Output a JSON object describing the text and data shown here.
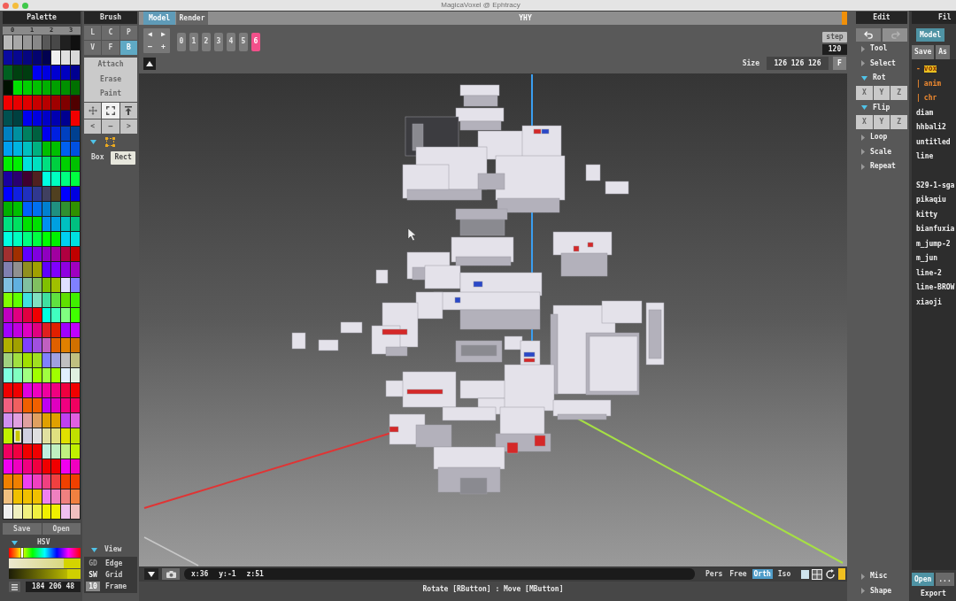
{
  "window": {
    "title": "MagicaVoxel @ Ephtracy"
  },
  "palette": {
    "title": "Palette",
    "pages": [
      "0",
      "1",
      "2",
      "3"
    ],
    "rows": [
      [
        {
          "color": "#b8b8b8",
          "selected": false
        },
        {
          "color": "#a8a8a8",
          "selected": false
        },
        {
          "color": "#989898",
          "selected": false
        },
        {
          "color": "#888888",
          "selected": false
        },
        {
          "color": "#585858",
          "selected": false
        },
        {
          "color": "#484848",
          "selected": false
        },
        {
          "color": "#202020",
          "selected": false
        },
        {
          "color": "#101010",
          "selected": false
        }
      ],
      [
        {
          "color": "#0a0aa0",
          "selected": false
        },
        {
          "color": "#080890",
          "selected": false
        },
        {
          "color": "#060680",
          "selected": false
        },
        {
          "color": "#040470",
          "selected": false
        },
        {
          "color": "#020250",
          "selected": false
        },
        {
          "color": "#f0f0f0",
          "selected": false
        },
        {
          "color": "#e0e0e0",
          "selected": false
        },
        {
          "color": "#d8d8d8",
          "selected": false
        }
      ],
      [
        {
          "color": "#006020",
          "selected": false
        },
        {
          "color": "#004010",
          "selected": false
        },
        {
          "color": "#003c10",
          "selected": false
        },
        {
          "color": "#0000f0",
          "selected": false
        },
        {
          "color": "#0000e0",
          "selected": false
        },
        {
          "color": "#0000d0",
          "selected": false
        },
        {
          "color": "#0000c0",
          "selected": false
        },
        {
          "color": "#000090",
          "selected": false
        }
      ],
      [
        {
          "color": "#001000",
          "selected": false
        },
        {
          "color": "#00e000",
          "selected": false
        },
        {
          "color": "#00d000",
          "selected": false
        },
        {
          "color": "#00c000",
          "selected": false
        },
        {
          "color": "#00b000",
          "selected": false
        },
        {
          "color": "#00a000",
          "selected": false
        },
        {
          "color": "#009000",
          "selected": false
        },
        {
          "color": "#007000",
          "selected": false
        }
      ],
      [
        {
          "color": "#f00000",
          "selected": false
        },
        {
          "color": "#e80000",
          "selected": false
        },
        {
          "color": "#e00000",
          "selected": false
        },
        {
          "color": "#c80000",
          "selected": false
        },
        {
          "color": "#b80000",
          "selected": false
        },
        {
          "color": "#a00000",
          "selected": false
        },
        {
          "color": "#800000",
          "selected": false
        },
        {
          "color": "#500000",
          "selected": false
        }
      ],
      [
        {
          "color": "#005050",
          "selected": false
        },
        {
          "color": "#004040",
          "selected": false
        },
        {
          "color": "#0000f0",
          "selected": false
        },
        {
          "color": "#0000e0",
          "selected": false
        },
        {
          "color": "#0000c8",
          "selected": false
        },
        {
          "color": "#0000b0",
          "selected": false
        },
        {
          "color": "#000090",
          "selected": false
        },
        {
          "color": "#f00000",
          "selected": false
        }
      ],
      [
        {
          "color": "#0080c0",
          "selected": false
        },
        {
          "color": "#0090a0",
          "selected": false
        },
        {
          "color": "#008060",
          "selected": false
        },
        {
          "color": "#006040",
          "selected": false
        },
        {
          "color": "#0000f0",
          "selected": false
        },
        {
          "color": "#0020e0",
          "selected": false
        },
        {
          "color": "#0040c0",
          "selected": false
        },
        {
          "color": "#004090",
          "selected": false
        }
      ],
      [
        {
          "color": "#00a0f0",
          "selected": false
        },
        {
          "color": "#00b4e0",
          "selected": false
        },
        {
          "color": "#00c0c0",
          "selected": false
        },
        {
          "color": "#00b080",
          "selected": false
        },
        {
          "color": "#00c000",
          "selected": false
        },
        {
          "color": "#00c000",
          "selected": false
        },
        {
          "color": "#0060f0",
          "selected": false
        },
        {
          "color": "#0050e0",
          "selected": false
        }
      ],
      [
        {
          "color": "#00f000",
          "selected": false
        },
        {
          "color": "#00f000",
          "selected": false
        },
        {
          "color": "#00e0e0",
          "selected": false
        },
        {
          "color": "#00e0c0",
          "selected": false
        },
        {
          "color": "#00e080",
          "selected": false
        },
        {
          "color": "#00d040",
          "selected": false
        },
        {
          "color": "#00d000",
          "selected": false
        },
        {
          "color": "#00c000",
          "selected": false
        }
      ],
      [
        {
          "color": "#1a00a0",
          "selected": false
        },
        {
          "color": "#2a0070",
          "selected": false
        },
        {
          "color": "#400030",
          "selected": false
        },
        {
          "color": "#502020",
          "selected": false
        },
        {
          "color": "#00ffe0",
          "selected": false
        },
        {
          "color": "#00ffc0",
          "selected": false
        },
        {
          "color": "#00ff80",
          "selected": false
        },
        {
          "color": "#00ff40",
          "selected": false
        }
      ],
      [
        {
          "color": "#0000ff",
          "selected": false
        },
        {
          "color": "#1020e0",
          "selected": false
        },
        {
          "color": "#2030c0",
          "selected": false
        },
        {
          "color": "#303890",
          "selected": false
        },
        {
          "color": "#404060",
          "selected": false
        },
        {
          "color": "#504020",
          "selected": false
        },
        {
          "color": "#0000ff",
          "selected": false
        },
        {
          "color": "#0000e0",
          "selected": false
        }
      ],
      [
        {
          "color": "#00b000",
          "selected": false
        },
        {
          "color": "#00c000",
          "selected": false
        },
        {
          "color": "#0060ff",
          "selected": false
        },
        {
          "color": "#0070f0",
          "selected": false
        },
        {
          "color": "#0080d0",
          "selected": false
        },
        {
          "color": "#209080",
          "selected": false
        },
        {
          "color": "#309030",
          "selected": false
        },
        {
          "color": "#309000",
          "selected": false
        }
      ],
      [
        {
          "color": "#00e080",
          "selected": false
        },
        {
          "color": "#00e060",
          "selected": false
        },
        {
          "color": "#00e000",
          "selected": false
        },
        {
          "color": "#00e000",
          "selected": false
        },
        {
          "color": "#0090f0",
          "selected": false
        },
        {
          "color": "#00a0e0",
          "selected": false
        },
        {
          "color": "#00c0c0",
          "selected": false
        },
        {
          "color": "#00c080",
          "selected": false
        }
      ],
      [
        {
          "color": "#00ffe0",
          "selected": false
        },
        {
          "color": "#00ffc0",
          "selected": false
        },
        {
          "color": "#00ff80",
          "selected": false
        },
        {
          "color": "#00ff40",
          "selected": false
        },
        {
          "color": "#00ff00",
          "selected": false
        },
        {
          "color": "#00f000",
          "selected": false
        },
        {
          "color": "#00d0f0",
          "selected": false
        },
        {
          "color": "#00e0e0",
          "selected": false
        }
      ],
      [
        {
          "color": "#a03030",
          "selected": false
        },
        {
          "color": "#a03000",
          "selected": false
        },
        {
          "color": "#6000ff",
          "selected": false
        },
        {
          "color": "#8000e0",
          "selected": false
        },
        {
          "color": "#9000c0",
          "selected": false
        },
        {
          "color": "#a000a0",
          "selected": false
        },
        {
          "color": "#b00040",
          "selected": false
        },
        {
          "color": "#c00000",
          "selected": false
        }
      ],
      [
        {
          "color": "#8080b0",
          "selected": false
        },
        {
          "color": "#909090",
          "selected": false
        },
        {
          "color": "#909020",
          "selected": false
        },
        {
          "color": "#a0a000",
          "selected": false
        },
        {
          "color": "#6000ff",
          "selected": false
        },
        {
          "color": "#8000ff",
          "selected": false
        },
        {
          "color": "#9000e0",
          "selected": false
        },
        {
          "color": "#a000c0",
          "selected": false
        }
      ],
      [
        {
          "color": "#80c0e0",
          "selected": false
        },
        {
          "color": "#60b0e0",
          "selected": false
        },
        {
          "color": "#80c0a0",
          "selected": false
        },
        {
          "color": "#80c060",
          "selected": false
        },
        {
          "color": "#80c000",
          "selected": false
        },
        {
          "color": "#a0c000",
          "selected": false
        },
        {
          "color": "#e0e0ff",
          "selected": false
        },
        {
          "color": "#8080ff",
          "selected": false
        }
      ],
      [
        {
          "color": "#80ff00",
          "selected": false
        },
        {
          "color": "#60ff00",
          "selected": false
        },
        {
          "color": "#40e0e0",
          "selected": false
        },
        {
          "color": "#80e0c0",
          "selected": false
        },
        {
          "color": "#40e0a0",
          "selected": false
        },
        {
          "color": "#60e040",
          "selected": false
        },
        {
          "color": "#60e000",
          "selected": false
        },
        {
          "color": "#40f000",
          "selected": false
        }
      ],
      [
        {
          "color": "#c000c0",
          "selected": false
        },
        {
          "color": "#e00080",
          "selected": false
        },
        {
          "color": "#e00040",
          "selected": false
        },
        {
          "color": "#f00000",
          "selected": false
        },
        {
          "color": "#00ffe0",
          "selected": false
        },
        {
          "color": "#40ffc0",
          "selected": false
        },
        {
          "color": "#80ff80",
          "selected": false
        },
        {
          "color": "#40ff00",
          "selected": false
        }
      ],
      [
        {
          "color": "#a000ff",
          "selected": false
        },
        {
          "color": "#c000e0",
          "selected": false
        },
        {
          "color": "#e000c0",
          "selected": false
        },
        {
          "color": "#e00080",
          "selected": false
        },
        {
          "color": "#e02020",
          "selected": false
        },
        {
          "color": "#e02000",
          "selected": false
        },
        {
          "color": "#a000ff",
          "selected": false
        },
        {
          "color": "#c000ff",
          "selected": false
        }
      ],
      [
        {
          "color": "#b0b000",
          "selected": false
        },
        {
          "color": "#a0a000",
          "selected": false
        },
        {
          "color": "#8040ff",
          "selected": false
        },
        {
          "color": "#a050e0",
          "selected": false
        },
        {
          "color": "#c060c0",
          "selected": false
        },
        {
          "color": "#e06000",
          "selected": false
        },
        {
          "color": "#e08000",
          "selected": false
        },
        {
          "color": "#d07000",
          "selected": false
        }
      ],
      [
        {
          "color": "#a0d080",
          "selected": false
        },
        {
          "color": "#a0e040",
          "selected": false
        },
        {
          "color": "#a0e000",
          "selected": false
        },
        {
          "color": "#a0e020",
          "selected": false
        },
        {
          "color": "#8080ff",
          "selected": false
        },
        {
          "color": "#a0a0e0",
          "selected": false
        },
        {
          "color": "#c0c0c0",
          "selected": false
        },
        {
          "color": "#c0c080",
          "selected": false
        }
      ],
      [
        {
          "color": "#80ffe0",
          "selected": false
        },
        {
          "color": "#80ffc0",
          "selected": false
        },
        {
          "color": "#a0ff80",
          "selected": false
        },
        {
          "color": "#a0ff00",
          "selected": false
        },
        {
          "color": "#a0ff40",
          "selected": false
        },
        {
          "color": "#a0ff00",
          "selected": false
        },
        {
          "color": "#e0f0ff",
          "selected": false
        },
        {
          "color": "#e0f0e0",
          "selected": false
        }
      ],
      [
        {
          "color": "#f00000",
          "selected": false
        },
        {
          "color": "#f00000",
          "selected": false
        },
        {
          "color": "#e000e0",
          "selected": false
        },
        {
          "color": "#f000c0",
          "selected": false
        },
        {
          "color": "#f000a0",
          "selected": false
        },
        {
          "color": "#f00080",
          "selected": false
        },
        {
          "color": "#f00040",
          "selected": false
        },
        {
          "color": "#f00000",
          "selected": false
        }
      ],
      [
        {
          "color": "#f06080",
          "selected": false
        },
        {
          "color": "#f06060",
          "selected": false
        },
        {
          "color": "#f06000",
          "selected": false
        },
        {
          "color": "#f06000",
          "selected": false
        },
        {
          "color": "#c000f0",
          "selected": false
        },
        {
          "color": "#e000c0",
          "selected": false
        },
        {
          "color": "#f00080",
          "selected": false
        },
        {
          "color": "#f00060",
          "selected": false
        }
      ],
      [
        {
          "color": "#d090f0",
          "selected": false
        },
        {
          "color": "#e0a0e0",
          "selected": false
        },
        {
          "color": "#e0a0a0",
          "selected": false
        },
        {
          "color": "#e0a060",
          "selected": false
        },
        {
          "color": "#e0a000",
          "selected": false
        },
        {
          "color": "#e0a000",
          "selected": false
        },
        {
          "color": "#c040f0",
          "selected": false
        },
        {
          "color": "#e060e0",
          "selected": false
        }
      ],
      [
        {
          "color": "#c0f000",
          "selected": false
        },
        {
          "color": "#c8c800",
          "selected": true
        },
        {
          "color": "#d0d0e0",
          "selected": false
        },
        {
          "color": "#e0e0e0",
          "selected": false
        },
        {
          "color": "#e0e0a0",
          "selected": false
        },
        {
          "color": "#e0e080",
          "selected": false
        },
        {
          "color": "#e0e000",
          "selected": false
        },
        {
          "color": "#c0e000",
          "selected": false
        }
      ],
      [
        {
          "color": "#f00060",
          "selected": false
        },
        {
          "color": "#f00040",
          "selected": false
        },
        {
          "color": "#f00000",
          "selected": false
        },
        {
          "color": "#f00000",
          "selected": false
        },
        {
          "color": "#c0f0e0",
          "selected": false
        },
        {
          "color": "#c0f0c0",
          "selected": false
        },
        {
          "color": "#c0f080",
          "selected": false
        },
        {
          "color": "#c0f000",
          "selected": false
        }
      ],
      [
        {
          "color": "#f000f0",
          "selected": false
        },
        {
          "color": "#f000c0",
          "selected": false
        },
        {
          "color": "#f00080",
          "selected": false
        },
        {
          "color": "#f00040",
          "selected": false
        },
        {
          "color": "#f00000",
          "selected": false
        },
        {
          "color": "#f00000",
          "selected": false
        },
        {
          "color": "#f000f0",
          "selected": false
        },
        {
          "color": "#f000c0",
          "selected": false
        }
      ],
      [
        {
          "color": "#f08000",
          "selected": false
        },
        {
          "color": "#f08000",
          "selected": false
        },
        {
          "color": "#f040f0",
          "selected": false
        },
        {
          "color": "#f040c0",
          "selected": false
        },
        {
          "color": "#f04080",
          "selected": false
        },
        {
          "color": "#f04040",
          "selected": false
        },
        {
          "color": "#f04000",
          "selected": false
        },
        {
          "color": "#f04000",
          "selected": false
        }
      ],
      [
        {
          "color": "#f0c080",
          "selected": false
        },
        {
          "color": "#f0c000",
          "selected": false
        },
        {
          "color": "#f0c000",
          "selected": false
        },
        {
          "color": "#f0c000",
          "selected": false
        },
        {
          "color": "#f080f0",
          "selected": false
        },
        {
          "color": "#f080c0",
          "selected": false
        },
        {
          "color": "#f08080",
          "selected": false
        },
        {
          "color": "#f08040",
          "selected": false
        }
      ],
      [
        {
          "color": "#f0f0f0",
          "selected": false
        },
        {
          "color": "#f0f0c0",
          "selected": false
        },
        {
          "color": "#f0f080",
          "selected": false
        },
        {
          "color": "#f0f040",
          "selected": false
        },
        {
          "color": "#f0f000",
          "selected": false
        },
        {
          "color": "#f0f000",
          "selected": false
        },
        {
          "color": "#f0c0f0",
          "selected": false
        },
        {
          "color": "#f0c0c0",
          "selected": false
        }
      ]
    ],
    "buttons": [
      "Save",
      "Open"
    ]
  },
  "color_picker": {
    "mode": "HSV",
    "expanded": true,
    "sliders": [
      {
        "kind": "hue",
        "level": 0.19
      },
      {
        "kind": "saturation",
        "level": 0.76
      },
      {
        "kind": "value",
        "level": 0.82
      }
    ],
    "value": "184 206 48"
  },
  "brush": {
    "title": "Brush",
    "shapes": [
      {
        "label": "L",
        "selected": false
      },
      {
        "label": "C",
        "selected": false
      },
      {
        "label": "P",
        "selected": false
      },
      {
        "label": "V",
        "selected": false
      },
      {
        "label": "F",
        "selected": false
      },
      {
        "label": "B",
        "selected": true
      }
    ],
    "modes": [
      "Attach",
      "Erase",
      "Paint"
    ],
    "tools": [
      {
        "kind": "move",
        "selected": false
      },
      {
        "kind": "select",
        "selected": true
      },
      {
        "kind": "pin",
        "selected": false
      }
    ],
    "steppers": [
      "<",
      "—",
      ">"
    ],
    "options": {
      "expanded": true,
      "types": [
        {
          "label": "Box",
          "selected": false
        },
        {
          "label": "Rect",
          "selected": true
        }
      ]
    }
  },
  "view": {
    "title": "View",
    "expanded": true,
    "options": [
      {
        "kind": "toggle",
        "key": "GD",
        "label": "Edge",
        "on": false
      },
      {
        "kind": "toggle",
        "key": "SW",
        "label": "Grid",
        "on": true
      },
      {
        "kind": "value",
        "key": "10",
        "label": "Frame"
      }
    ]
  },
  "tabs": [
    {
      "label": "Model",
      "selected": true
    },
    {
      "label": "Render",
      "selected": false
    }
  ],
  "document_title": "YHY",
  "toolbar": {
    "nav": [
      "◀",
      "▶",
      "–",
      "+"
    ],
    "frames": [
      {
        "label": "0",
        "selected": false
      },
      {
        "label": "1",
        "selected": false
      },
      {
        "label": "2",
        "selected": false
      },
      {
        "label": "3",
        "selected": false
      },
      {
        "label": "4",
        "selected": false
      },
      {
        "label": "5",
        "selected": false
      },
      {
        "label": "6",
        "selected": true
      }
    ],
    "step": {
      "label": "step",
      "value": "120"
    },
    "size": {
      "label": "Size",
      "value": "126 126 126",
      "button": "F"
    }
  },
  "status_bar": {
    "coordinates": [
      "x:36",
      "y:-1",
      "z:51"
    ],
    "projections": [
      {
        "label": "Pers",
        "selected": false
      },
      {
        "label": "Free",
        "selected": false
      },
      {
        "label": "Orth",
        "selected": true
      },
      {
        "label": "Iso",
        "selected": false
      }
    ],
    "hint": "Rotate [RButton] : Move [MButton]"
  },
  "edit": {
    "title": "Edit",
    "history": [
      {
        "kind": "undo",
        "disabled": false
      },
      {
        "kind": "redo",
        "disabled": true
      }
    ],
    "sections": [
      {
        "label": "Tool",
        "expanded": false
      },
      {
        "label": "Select",
        "expanded": false
      },
      {
        "label": "Rot",
        "expanded": true,
        "axes": [
          "X",
          "Y",
          "Z"
        ]
      },
      {
        "label": "Flip",
        "expanded": true,
        "axes": [
          "X",
          "Y",
          "Z"
        ]
      },
      {
        "label": "Loop",
        "expanded": false
      },
      {
        "label": "Scale",
        "expanded": false
      },
      {
        "label": "Repeat",
        "expanded": false
      }
    ],
    "footer_sections": [
      {
        "label": "Misc",
        "expanded": false
      },
      {
        "label": "Shape",
        "expanded": false
      }
    ]
  },
  "file": {
    "title": "Fil",
    "tabs": [
      {
        "label": "Model",
        "selected": true
      }
    ],
    "buttons": [
      "Save",
      "As"
    ],
    "sections": [
      {
        "items": [
          {
            "kind": "folder",
            "prefix": "-",
            "label": "vox",
            "selected": true,
            "children": [
              {
                "kind": "folder",
                "prefix": "|",
                "label": "anim",
                "selected": false
              },
              {
                "kind": "folder",
                "prefix": "|",
                "label": "chr",
                "selected": false
              }
            ]
          },
          {
            "kind": "file",
            "label": "diam",
            "selected": false
          },
          {
            "kind": "file",
            "label": "hhbali2",
            "selected": false
          },
          {
            "kind": "file",
            "label": "untitled",
            "selected": false
          },
          {
            "kind": "file",
            "label": "line",
            "selected": false
          }
        ]
      },
      {
        "items": [
          {
            "kind": "file",
            "label": "S29-1-sga",
            "selected": false
          },
          {
            "kind": "file",
            "label": "pikaqiu",
            "selected": false
          },
          {
            "kind": "file",
            "label": "kitty",
            "selected": false
          },
          {
            "kind": "file",
            "label": "bianfuxia",
            "selected": false
          },
          {
            "kind": "file",
            "label": "m_jump-2",
            "selected": false
          },
          {
            "kind": "file",
            "label": "m_jun",
            "selected": false
          },
          {
            "kind": "file",
            "label": "line-2",
            "selected": false
          },
          {
            "kind": "file",
            "label": "line-BROW",
            "selected": false
          },
          {
            "kind": "file",
            "label": "xiaoji",
            "selected": false
          }
        ]
      }
    ],
    "footer_buttons": [
      "Open",
      "..."
    ],
    "export_label": "Export"
  }
}
